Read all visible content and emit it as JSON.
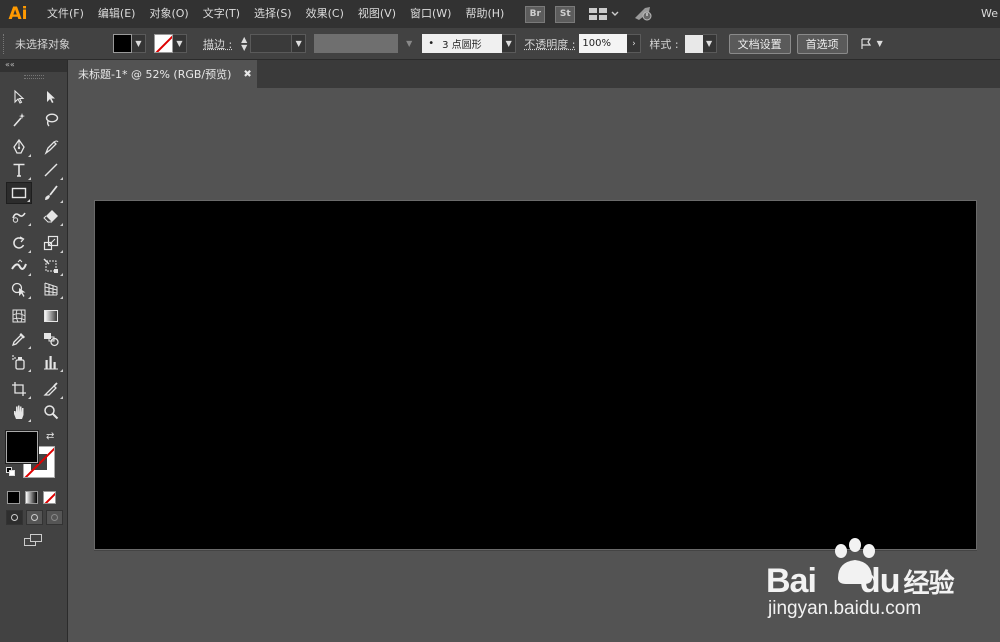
{
  "menubar": {
    "app_logo": "Ai",
    "items": [
      "文件(F)",
      "编辑(E)",
      "对象(O)",
      "文字(T)",
      "选择(S)",
      "效果(C)",
      "视图(V)",
      "窗口(W)",
      "帮助(H)"
    ],
    "bridge_label": "Br",
    "stock_label": "St",
    "workspace_label": "We"
  },
  "control": {
    "selection_status": "未选择对象",
    "stroke_label": "描边 :",
    "brush_value": "3 点圆形",
    "opacity_label": "不透明度 :",
    "opacity_value": "100%",
    "style_label": "样式 :",
    "doc_setup_label": "文档设置",
    "prefs_label": "首选项"
  },
  "tab": {
    "title": "未标题-1* @ 52% (RGB/预览)",
    "close": "✖"
  },
  "watermark": {
    "brand_latin": "Bai",
    "brand_du": "du",
    "brand_cn": "经验",
    "url": "jingyan.baidu.com"
  },
  "colors": {
    "accent": "#ff9a00",
    "chrome_dark": "#323232",
    "chrome_panel": "#424242",
    "canvas_bg": "#535353",
    "artboard_fill": "#000000",
    "none_slash": "#dd0000"
  },
  "tools": [
    "selection-tool",
    "direct-selection-tool",
    "magic-wand-tool",
    "lasso-tool",
    "pen-tool",
    "curvature-tool",
    "type-tool",
    "line-segment-tool",
    "rectangle-tool",
    "paintbrush-tool",
    "shaper-tool",
    "eraser-tool",
    "rotate-tool",
    "scale-tool",
    "width-tool",
    "free-transform-tool",
    "shape-builder-tool",
    "perspective-grid-tool",
    "mesh-tool",
    "gradient-tool",
    "eyedropper-tool",
    "blend-tool",
    "symbol-sprayer-tool",
    "column-graph-tool",
    "artboard-tool",
    "slice-tool",
    "hand-tool",
    "zoom-tool"
  ]
}
